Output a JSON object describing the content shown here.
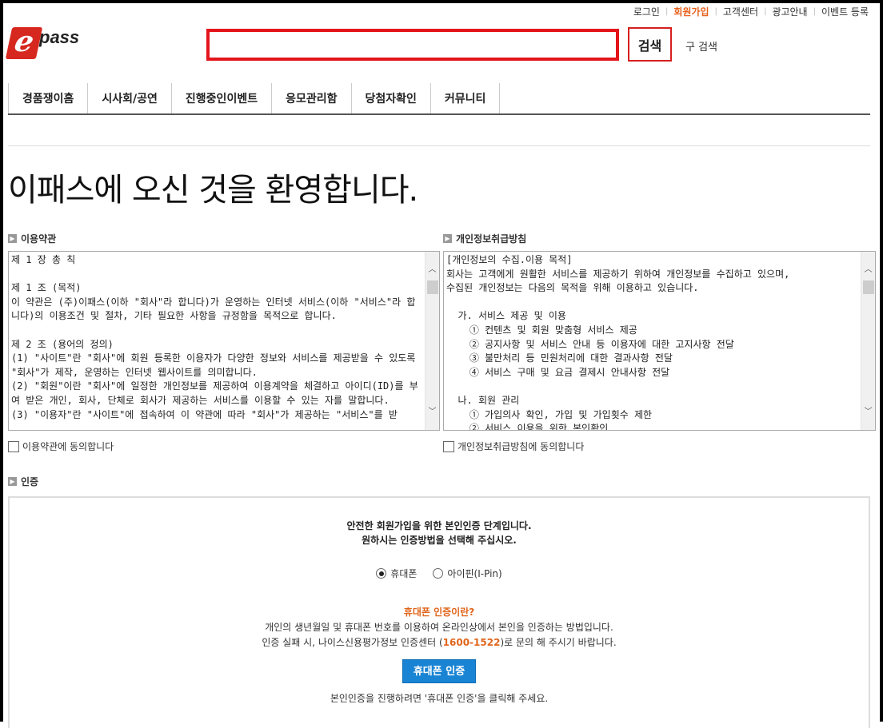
{
  "util_links": [
    {
      "label": "로그인",
      "highlight": false
    },
    {
      "label": "회원가입",
      "highlight": true
    },
    {
      "label": "고객센터",
      "highlight": false
    },
    {
      "label": "광고안내",
      "highlight": false
    },
    {
      "label": "이벤트 등록",
      "highlight": false
    }
  ],
  "logo": {
    "letter": "e",
    "word": "pass"
  },
  "search": {
    "value": "",
    "placeholder": "",
    "button_label": "검색",
    "old_search_label": "구 검색"
  },
  "gnb": [
    "경품쟁이홈",
    "시사회/공연",
    "진행중인이벤트",
    "응모관리함",
    "당첨자확인",
    "커뮤니티"
  ],
  "welcome": "이패스에 오신 것을 환영합니다.",
  "terms": {
    "title": "이용약관",
    "text": "제 1 장 총 칙\n\n제 1 조 (목적)\n이 약관은 (주)이패스(이하 \"회사\"라 합니다)가 운영하는 인터넷 서비스(이하 \"서비스\"라 합니다)의 이용조건 및 절차, 기타 필요한 사항을 규정함을 목적으로 합니다.\n\n제 2 조 (용어의 정의)\n(1) \"사이트\"란 \"회사\"에 회원 등록한 이용자가 다양한 정보와 서비스를 제공받을 수 있도록 \"회사\"가 제작, 운영하는 인터넷 웹사이트를 의미합니다.\n(2) \"회원\"이란 \"회사\"에 일정한 개인정보를 제공하여 이용계약을 체결하고 아이디(ID)를 부여 받은 개인, 회사, 단체로 회사가 제공하는 서비스를 이용할 수 있는 자를 말합니다.\n(3) \"이용자\"란 \"사이트\"에 접속하여 이 약관에 따라 \"회사\"가 제공하는 \"서비스\"를 받",
    "agree_label": "이용약관에 동의합니다"
  },
  "privacy": {
    "title": "개인정보취급방침",
    "text": "[개인정보의 수집.이용 목적]\n회사는 고객에게 원활한 서비스를 제공하기 위하여 개인정보를 수집하고 있으며,\n수집된 개인정보는 다음의 목적을 위해 이용하고 있습니다.\n\n  가. 서비스 제공 및 이용\n    ① 컨텐츠 및 회원 맞춤형 서비스 제공\n    ② 공지사항 및 서비스 안내 등 이용자에 대한 고지사항 전달\n    ③ 불만처리 등 민원처리에 대한 결과사항 전달\n    ④ 서비스 구매 및 요금 결제시 안내사항 전달\n\n  나. 회원 관리\n    ① 가입의사 확인, 가입 및 가입횟수 제한\n    ② 서비스 이용을 위한 본인확인",
    "agree_label": "개인정보취급방침에 동의합니다"
  },
  "auth": {
    "title": "인증",
    "guide_line1": "안전한 회원가입을 위한 본인인증 단계입니다.",
    "guide_line2": "원하시는 인증방법을 선택해 주십시오.",
    "options": [
      {
        "label": "휴대폰",
        "selected": true
      },
      {
        "label": "아이핀(I-Pin)",
        "selected": false
      }
    ],
    "what_title": "휴대폰 인증이란?",
    "desc_line1": "개인의 생년월일 및 휴대폰 번호를 이용하여 온라인상에서 본인을 인증하는 방법입니다.",
    "desc_line2_pre": "인증 실패 시, 나이스신용평가정보 인증센터 (",
    "desc_phone": "1600-1522",
    "desc_line2_post": ")로 문의 해 주시기 바랍니다.",
    "button_label": "휴대폰 인증",
    "note": "본인인증을 진행하려면 '휴대폰 인증'을 클릭해 주세요."
  },
  "colors": {
    "accent": "#e8601c",
    "search_border": "#e4141b",
    "auth_button": "#1a84d4"
  }
}
